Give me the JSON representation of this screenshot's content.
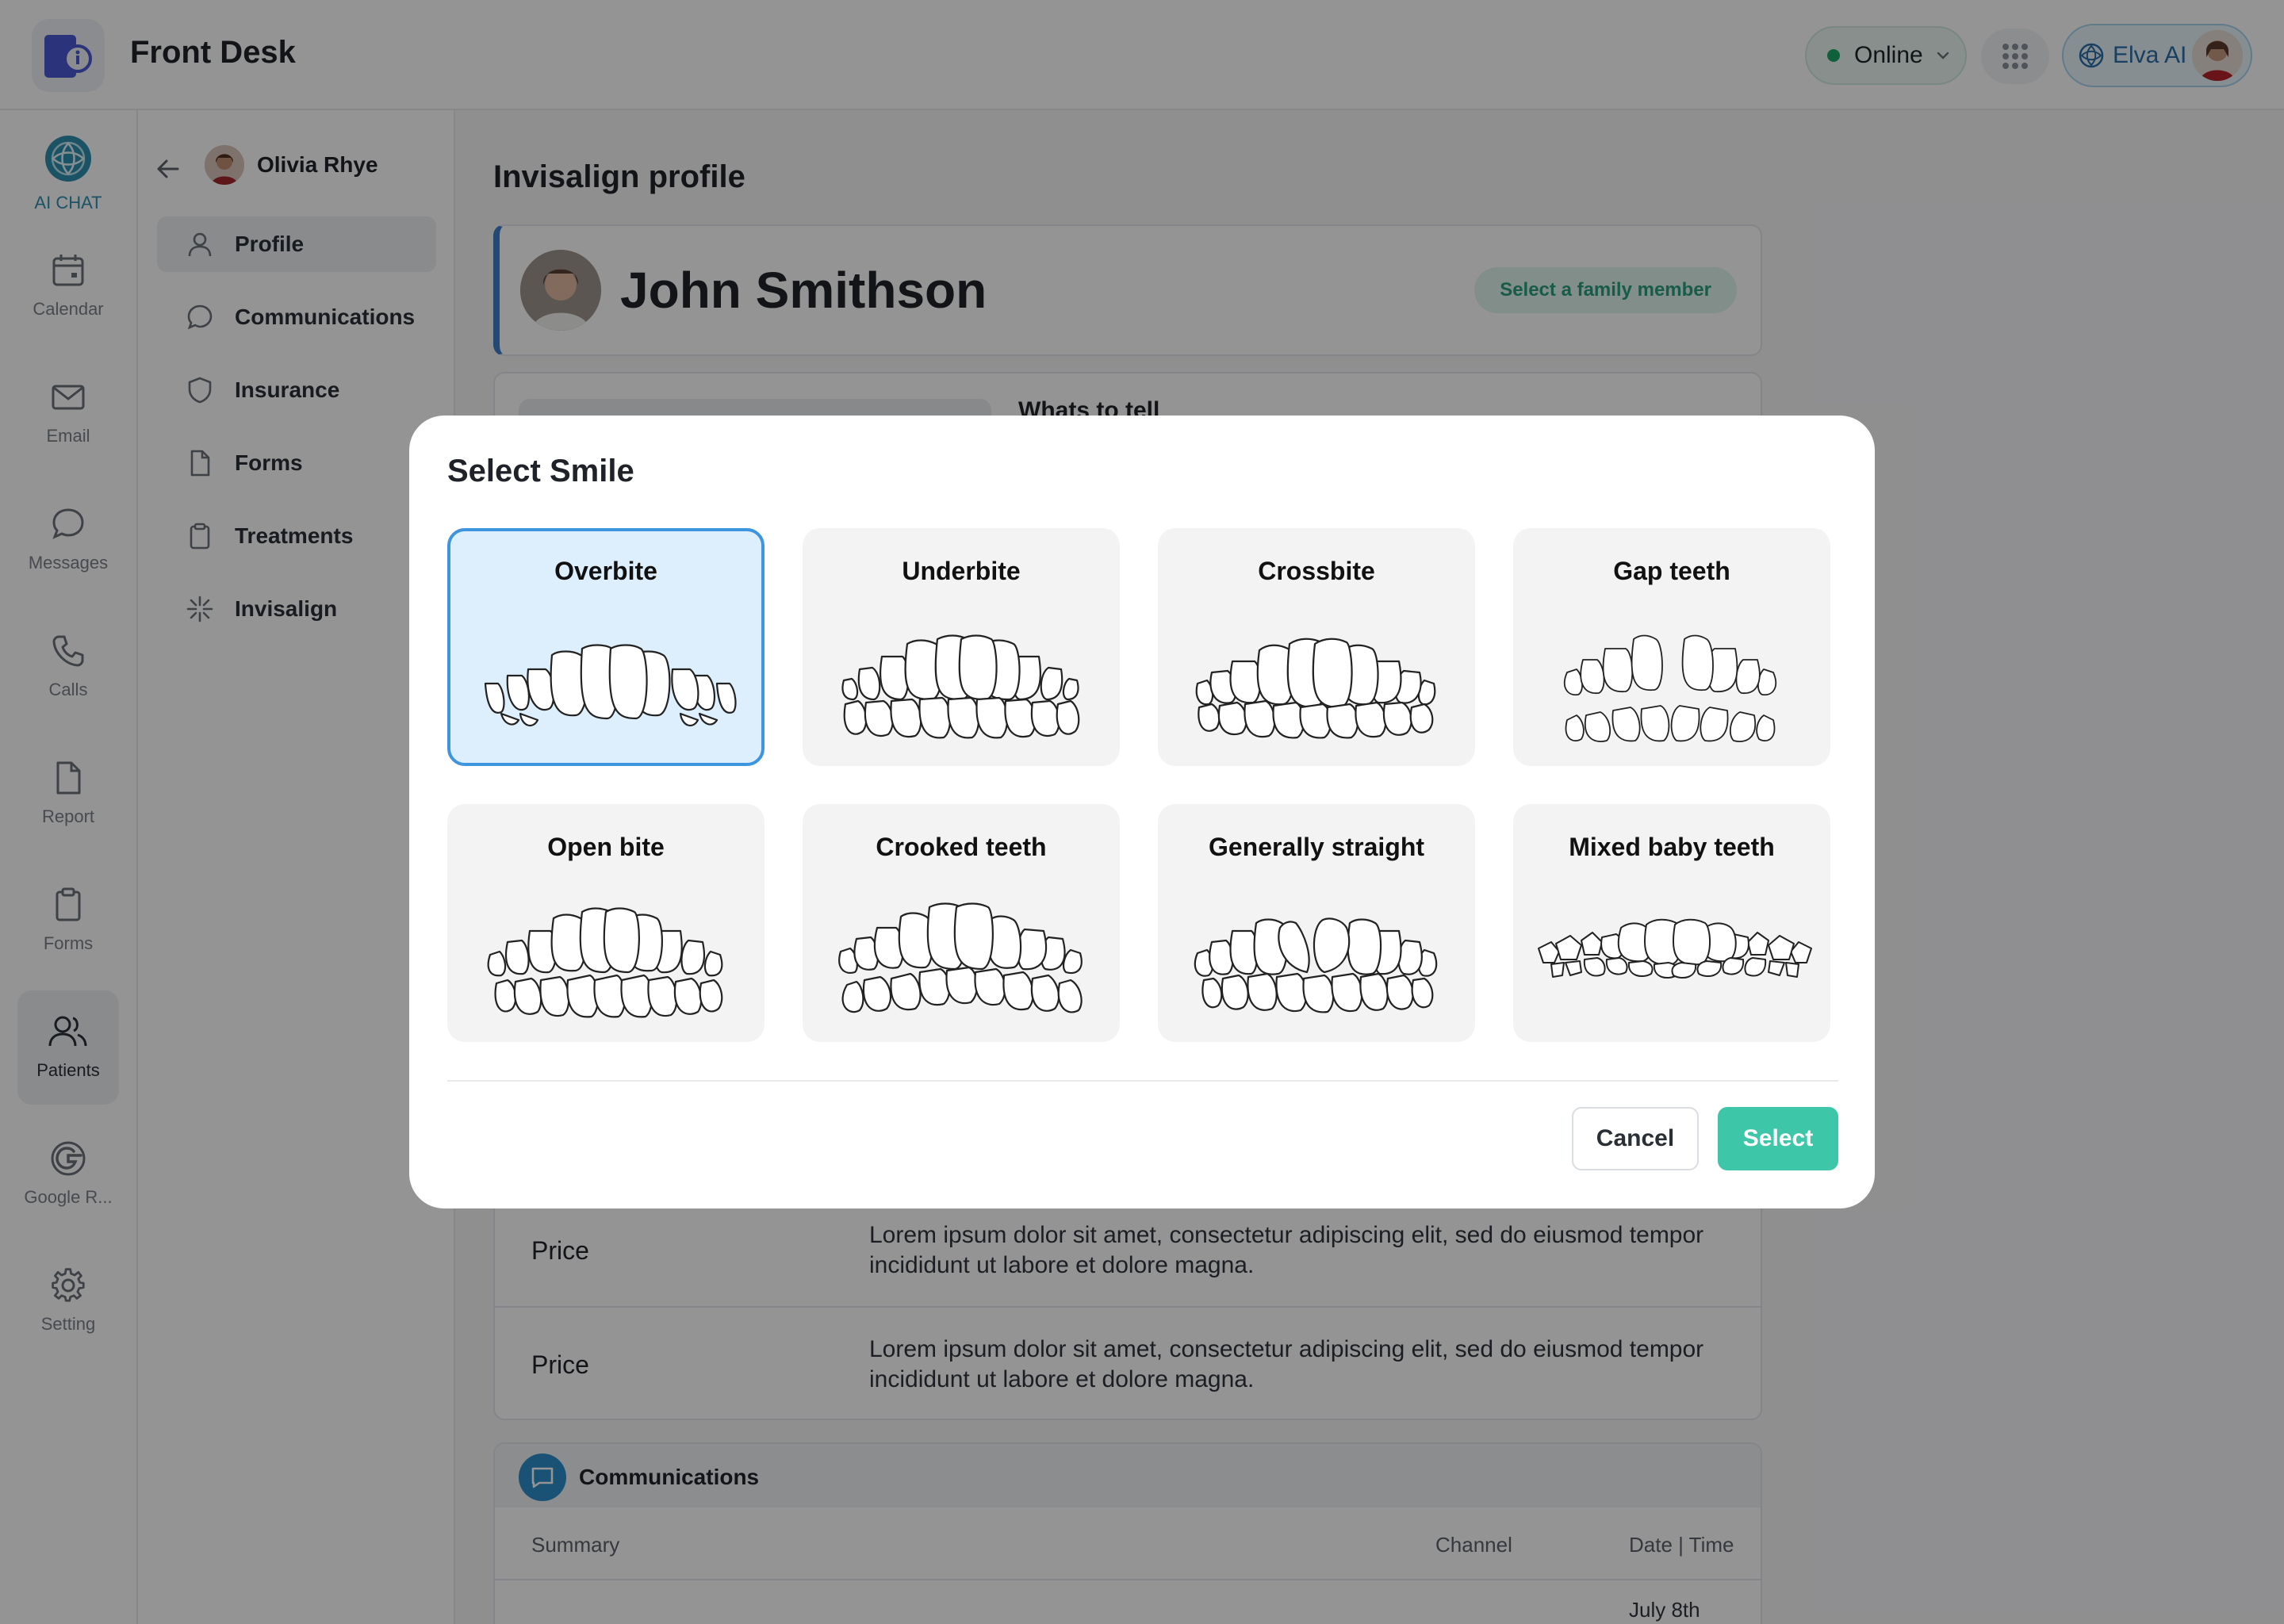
{
  "app": {
    "title": "Front Desk"
  },
  "status": {
    "label": "Online",
    "color": "#1aa866"
  },
  "user": {
    "name": "Elva AI"
  },
  "rail": {
    "items": [
      {
        "label": "AI CHAT",
        "icon": "ai-chat-icon"
      },
      {
        "label": "Calendar",
        "icon": "calendar-icon"
      },
      {
        "label": "Email",
        "icon": "mail-icon"
      },
      {
        "label": "Messages",
        "icon": "chat-bubble-icon"
      },
      {
        "label": "Calls",
        "icon": "phone-icon"
      },
      {
        "label": "Report",
        "icon": "document-icon"
      },
      {
        "label": "Forms",
        "icon": "clipboard-icon"
      },
      {
        "label": "Patients",
        "icon": "users-icon"
      },
      {
        "label": "Google R...",
        "icon": "google-icon"
      },
      {
        "label": "Setting",
        "icon": "gear-icon"
      }
    ],
    "active": "Patients"
  },
  "subnav": {
    "patient_name": "Olivia Rhye",
    "items": [
      {
        "label": "Profile",
        "icon": "user-icon"
      },
      {
        "label": "Communications",
        "icon": "chat-bubble-icon"
      },
      {
        "label": "Insurance",
        "icon": "shield-icon"
      },
      {
        "label": "Forms",
        "icon": "document-icon"
      },
      {
        "label": "Treatments",
        "icon": "clipboard-icon"
      },
      {
        "label": "Invisalign",
        "icon": "sparkle-icon"
      }
    ],
    "active": "Profile"
  },
  "main": {
    "section_title": "Invisalign profile",
    "patient_name": "John Smithson",
    "family_button": "Select a family member",
    "info_peek_text": "Whats to tell",
    "price_rows": [
      {
        "label": "Price",
        "description": "Lorem ipsum dolor sit amet, consectetur adipiscing elit, sed do eiusmod tempor incididunt ut labore et dolore magna."
      },
      {
        "label": "Price",
        "description": "Lorem ipsum dolor sit amet, consectetur adipiscing elit, sed do eiusmod tempor incididunt ut labore et dolore magna."
      }
    ],
    "communications": {
      "title": "Communications",
      "columns": [
        "Summary",
        "Channel",
        "Date | Time"
      ],
      "first_row_date": "July 8th"
    }
  },
  "modal": {
    "title": "Select Smile",
    "options": [
      {
        "label": "Overbite",
        "selected": true
      },
      {
        "label": "Underbite",
        "selected": false
      },
      {
        "label": "Crossbite",
        "selected": false
      },
      {
        "label": "Gap teeth",
        "selected": false
      },
      {
        "label": "Open bite",
        "selected": false
      },
      {
        "label": "Crooked teeth",
        "selected": false
      },
      {
        "label": "Generally straight",
        "selected": false
      },
      {
        "label": "Mixed baby teeth",
        "selected": false
      }
    ],
    "cancel_label": "Cancel",
    "select_label": "Select",
    "accent_color": "#3dc6a8",
    "selected_border_color": "#3d95dd"
  }
}
